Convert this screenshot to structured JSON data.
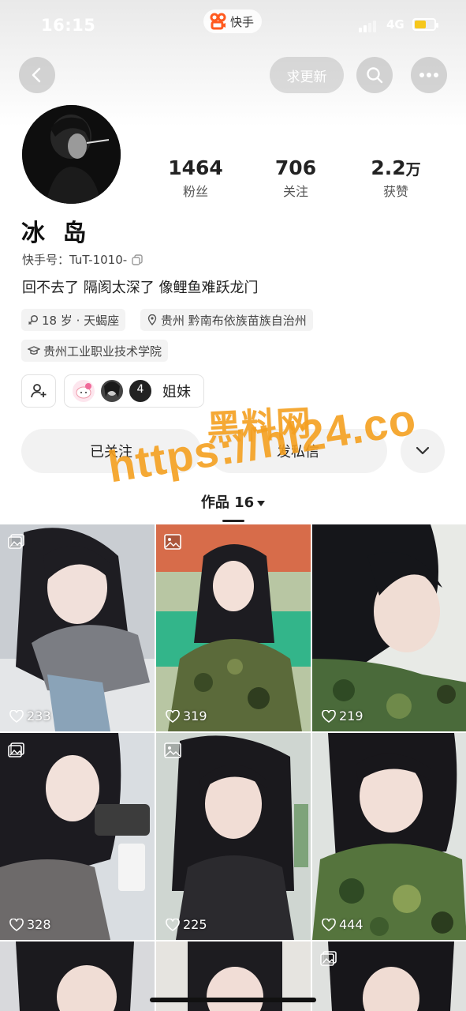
{
  "status_bar": {
    "time": "16:15",
    "network": "4G",
    "app_name": "快手"
  },
  "nav": {
    "request_update": "求更新"
  },
  "profile": {
    "name": "冰 岛",
    "kuaishou_id": "快手号：TuT-1010-",
    "bio": "回不去了 隔阂太深了 像鲤鱼难跃龙门",
    "stats": [
      {
        "value": "1464",
        "label": "粉丝"
      },
      {
        "value": "706",
        "label": "关注"
      },
      {
        "value": "2.2",
        "unit": "万",
        "label": "获赞"
      }
    ],
    "tags": {
      "age": "18 岁 · 天蝎座",
      "location": "贵州 黔南布依族苗族自治州",
      "school": "贵州工业职业技术学院"
    },
    "group": {
      "count": "4",
      "label": "姐妹"
    }
  },
  "actions": {
    "follow": "已关注",
    "message": "发私信"
  },
  "works_tab": {
    "label": "作品 16"
  },
  "watermark": {
    "line1": "黑料网",
    "line2": "https://hl24.co"
  },
  "posts": [
    {
      "likes": "233"
    },
    {
      "likes": "319"
    },
    {
      "likes": "219"
    },
    {
      "likes": "328"
    },
    {
      "likes": "225"
    },
    {
      "likes": "444"
    }
  ]
}
